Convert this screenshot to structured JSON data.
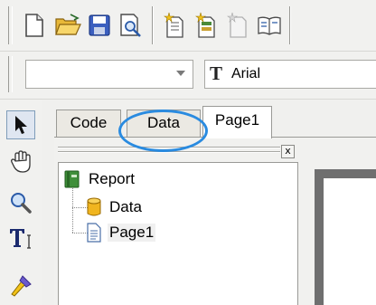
{
  "toolbar": {
    "buttons": [
      {
        "name": "new-page-icon"
      },
      {
        "name": "open-folder-icon"
      },
      {
        "name": "save-disk-icon"
      },
      {
        "name": "print-preview-icon"
      },
      {
        "name": "new-report-wizard-icon"
      },
      {
        "name": "report-options-icon"
      },
      {
        "name": "disabled-page-icon"
      },
      {
        "name": "book-icon"
      }
    ]
  },
  "formatting": {
    "style_value": "",
    "font_name": "Arial",
    "font_icon_glyph": "T"
  },
  "tools": [
    {
      "name": "select-arrow-icon",
      "active": true
    },
    {
      "name": "hand-icon"
    },
    {
      "name": "zoom-icon"
    },
    {
      "name": "text-tool-icon"
    },
    {
      "name": "format-painter-icon"
    }
  ],
  "tabs": [
    {
      "label": "Code"
    },
    {
      "label": "Data"
    },
    {
      "label": "Page1",
      "active": true
    }
  ],
  "panel": {
    "close_label": "x"
  },
  "tree": {
    "root": "Report",
    "children": [
      "Data",
      "Page1"
    ]
  },
  "annotation": {
    "highlight_color": "#2a8be0",
    "target": "Data tab"
  }
}
